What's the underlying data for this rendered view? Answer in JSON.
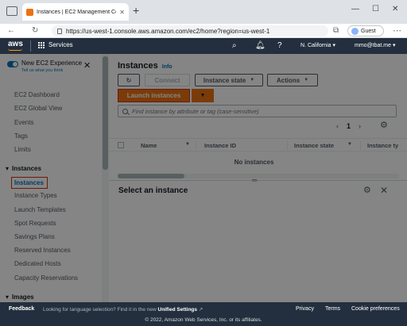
{
  "browser": {
    "tab_title": "Instances | EC2 Management Co",
    "url": "https://us-west-1.console.aws.amazon.com/ec2/home?region=us-west-1",
    "profile": "Guest"
  },
  "aws_nav": {
    "logo": "aws",
    "services": "Services",
    "region": "N. California ▾",
    "account": "mmo@tbat.me ▾"
  },
  "sidebar": {
    "new_experience": "New EC2 Experience",
    "tell_us": "Tell us what you think",
    "items_top": [
      "EC2 Dashboard",
      "EC2 Global View",
      "Events",
      "Tags",
      "Limits"
    ],
    "section_instances": "Instances",
    "active_item": "Instances",
    "instance_items": [
      "Instance Types",
      "Launch Templates",
      "Spot Requests",
      "Savings Plans",
      "Reserved Instances",
      "Dedicated Hosts",
      "Capacity Reservations"
    ],
    "section_images": "Images"
  },
  "main": {
    "title": "Instances",
    "info": "Info",
    "connect": "Connect",
    "instance_state": "Instance state",
    "actions": "Actions",
    "launch": "Launch instances",
    "search_placeholder": "Find instance by attribute or tag (case-sensitive)",
    "page": "1",
    "columns": [
      "Name",
      "Instance ID",
      "Instance state",
      "Instance ty"
    ],
    "empty": "No instances",
    "select_title": "Select an instance"
  },
  "footer": {
    "feedback": "Feedback",
    "lang_prefix": "Looking for language selection? Find it in the new",
    "lang_link": "Unified Settings",
    "privacy": "Privacy",
    "terms": "Terms",
    "cookies": "Cookie preferences",
    "copyright": "© 2022, Amazon Web Services, Inc. or its affiliates."
  },
  "colors": {
    "aws_nav": "#232f3e",
    "launch_button": "#ec7211",
    "highlight_border": "#d13212",
    "link": "#0073bb"
  }
}
